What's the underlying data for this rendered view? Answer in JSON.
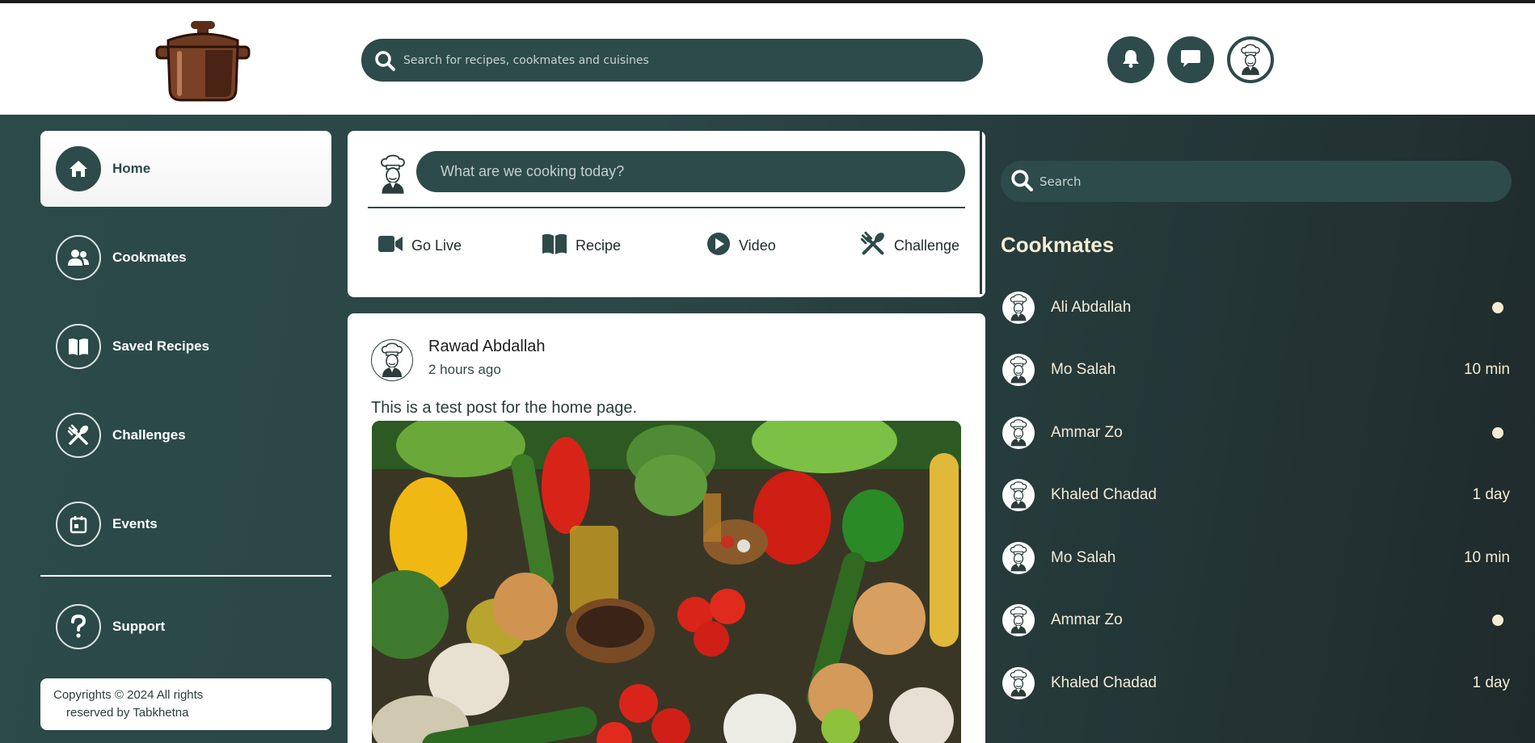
{
  "app": {
    "logo": "pot-logo"
  },
  "header": {
    "search_placeholder": "Search for recipes, cookmates and cuisines",
    "buttons": [
      "bell-icon",
      "chat-icon",
      "profile-avatar"
    ]
  },
  "sidebar": {
    "items": [
      {
        "label": "Home",
        "icon": "home-icon",
        "active": true
      },
      {
        "label": "Cookmates",
        "icon": "users-icon"
      },
      {
        "label": "Saved Recipes",
        "icon": "book-icon"
      },
      {
        "label": "Challenges",
        "icon": "utensils-icon"
      },
      {
        "label": "Events",
        "icon": "calendar-icon"
      }
    ],
    "support": {
      "label": "Support",
      "icon": "question-icon"
    },
    "copyright_line1": "Copyrights © 2024 All rights",
    "copyright_line2": "reserved by Tabkhetna"
  },
  "composer": {
    "placeholder": "What are we cooking today?",
    "actions": [
      {
        "label": "Go Live",
        "icon": "video-camera-icon"
      },
      {
        "label": "Recipe",
        "icon": "book-icon"
      },
      {
        "label": "Video",
        "icon": "play-icon"
      },
      {
        "label": "Challenge",
        "icon": "utensils-icon"
      }
    ]
  },
  "post": {
    "author": "Rawad Abdallah",
    "time": "2 hours ago",
    "text": "This is a test post for the home page."
  },
  "right_panel": {
    "search_placeholder": "Search",
    "title": "Cookmates",
    "mates": [
      {
        "name": "Ali Abdallah",
        "status": "online"
      },
      {
        "name": "Mo Salah",
        "status": "10 min"
      },
      {
        "name": "Ammar Zo",
        "status": "online"
      },
      {
        "name": "Khaled Chadad",
        "status": "1 day"
      },
      {
        "name": "Mo Salah",
        "status": "10 min"
      },
      {
        "name": "Ammar Zo",
        "status": "online"
      },
      {
        "name": "Khaled Chadad",
        "status": "1 day"
      }
    ]
  },
  "colors": {
    "primary": "#2d4b4a",
    "cream": "#f6ecd3",
    "dark_bg": "#1f2a2b"
  }
}
